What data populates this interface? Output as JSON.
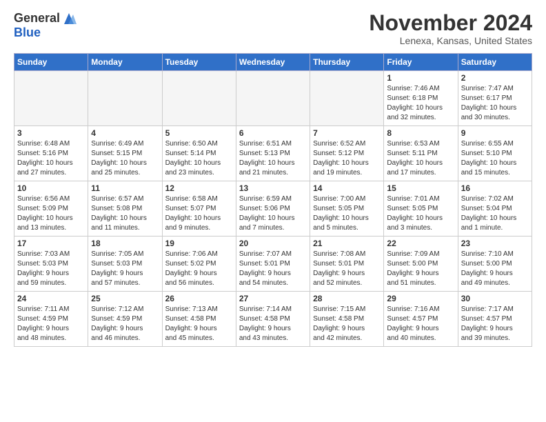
{
  "header": {
    "logo_line1": "General",
    "logo_line2": "Blue",
    "month_title": "November 2024",
    "location": "Lenexa, Kansas, United States"
  },
  "days_of_week": [
    "Sunday",
    "Monday",
    "Tuesday",
    "Wednesday",
    "Thursday",
    "Friday",
    "Saturday"
  ],
  "weeks": [
    [
      {
        "day": "",
        "info": ""
      },
      {
        "day": "",
        "info": ""
      },
      {
        "day": "",
        "info": ""
      },
      {
        "day": "",
        "info": ""
      },
      {
        "day": "",
        "info": ""
      },
      {
        "day": "1",
        "info": "Sunrise: 7:46 AM\nSunset: 6:18 PM\nDaylight: 10 hours\nand 32 minutes."
      },
      {
        "day": "2",
        "info": "Sunrise: 7:47 AM\nSunset: 6:17 PM\nDaylight: 10 hours\nand 30 minutes."
      }
    ],
    [
      {
        "day": "3",
        "info": "Sunrise: 6:48 AM\nSunset: 5:16 PM\nDaylight: 10 hours\nand 27 minutes."
      },
      {
        "day": "4",
        "info": "Sunrise: 6:49 AM\nSunset: 5:15 PM\nDaylight: 10 hours\nand 25 minutes."
      },
      {
        "day": "5",
        "info": "Sunrise: 6:50 AM\nSunset: 5:14 PM\nDaylight: 10 hours\nand 23 minutes."
      },
      {
        "day": "6",
        "info": "Sunrise: 6:51 AM\nSunset: 5:13 PM\nDaylight: 10 hours\nand 21 minutes."
      },
      {
        "day": "7",
        "info": "Sunrise: 6:52 AM\nSunset: 5:12 PM\nDaylight: 10 hours\nand 19 minutes."
      },
      {
        "day": "8",
        "info": "Sunrise: 6:53 AM\nSunset: 5:11 PM\nDaylight: 10 hours\nand 17 minutes."
      },
      {
        "day": "9",
        "info": "Sunrise: 6:55 AM\nSunset: 5:10 PM\nDaylight: 10 hours\nand 15 minutes."
      }
    ],
    [
      {
        "day": "10",
        "info": "Sunrise: 6:56 AM\nSunset: 5:09 PM\nDaylight: 10 hours\nand 13 minutes."
      },
      {
        "day": "11",
        "info": "Sunrise: 6:57 AM\nSunset: 5:08 PM\nDaylight: 10 hours\nand 11 minutes."
      },
      {
        "day": "12",
        "info": "Sunrise: 6:58 AM\nSunset: 5:07 PM\nDaylight: 10 hours\nand 9 minutes."
      },
      {
        "day": "13",
        "info": "Sunrise: 6:59 AM\nSunset: 5:06 PM\nDaylight: 10 hours\nand 7 minutes."
      },
      {
        "day": "14",
        "info": "Sunrise: 7:00 AM\nSunset: 5:05 PM\nDaylight: 10 hours\nand 5 minutes."
      },
      {
        "day": "15",
        "info": "Sunrise: 7:01 AM\nSunset: 5:05 PM\nDaylight: 10 hours\nand 3 minutes."
      },
      {
        "day": "16",
        "info": "Sunrise: 7:02 AM\nSunset: 5:04 PM\nDaylight: 10 hours\nand 1 minute."
      }
    ],
    [
      {
        "day": "17",
        "info": "Sunrise: 7:03 AM\nSunset: 5:03 PM\nDaylight: 9 hours\nand 59 minutes."
      },
      {
        "day": "18",
        "info": "Sunrise: 7:05 AM\nSunset: 5:03 PM\nDaylight: 9 hours\nand 57 minutes."
      },
      {
        "day": "19",
        "info": "Sunrise: 7:06 AM\nSunset: 5:02 PM\nDaylight: 9 hours\nand 56 minutes."
      },
      {
        "day": "20",
        "info": "Sunrise: 7:07 AM\nSunset: 5:01 PM\nDaylight: 9 hours\nand 54 minutes."
      },
      {
        "day": "21",
        "info": "Sunrise: 7:08 AM\nSunset: 5:01 PM\nDaylight: 9 hours\nand 52 minutes."
      },
      {
        "day": "22",
        "info": "Sunrise: 7:09 AM\nSunset: 5:00 PM\nDaylight: 9 hours\nand 51 minutes."
      },
      {
        "day": "23",
        "info": "Sunrise: 7:10 AM\nSunset: 5:00 PM\nDaylight: 9 hours\nand 49 minutes."
      }
    ],
    [
      {
        "day": "24",
        "info": "Sunrise: 7:11 AM\nSunset: 4:59 PM\nDaylight: 9 hours\nand 48 minutes."
      },
      {
        "day": "25",
        "info": "Sunrise: 7:12 AM\nSunset: 4:59 PM\nDaylight: 9 hours\nand 46 minutes."
      },
      {
        "day": "26",
        "info": "Sunrise: 7:13 AM\nSunset: 4:58 PM\nDaylight: 9 hours\nand 45 minutes."
      },
      {
        "day": "27",
        "info": "Sunrise: 7:14 AM\nSunset: 4:58 PM\nDaylight: 9 hours\nand 43 minutes."
      },
      {
        "day": "28",
        "info": "Sunrise: 7:15 AM\nSunset: 4:58 PM\nDaylight: 9 hours\nand 42 minutes."
      },
      {
        "day": "29",
        "info": "Sunrise: 7:16 AM\nSunset: 4:57 PM\nDaylight: 9 hours\nand 40 minutes."
      },
      {
        "day": "30",
        "info": "Sunrise: 7:17 AM\nSunset: 4:57 PM\nDaylight: 9 hours\nand 39 minutes."
      }
    ]
  ]
}
